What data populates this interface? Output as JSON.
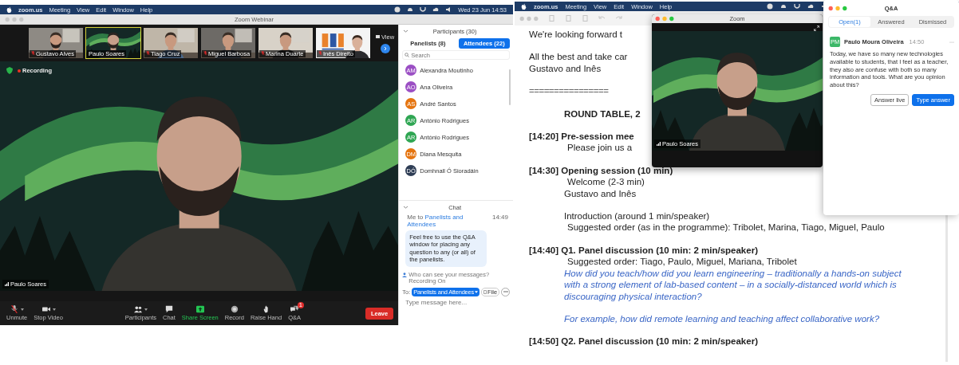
{
  "left_window": {
    "menu_bar": {
      "items": [
        "zoom.us",
        "Meeting",
        "View",
        "Edit",
        "Window",
        "Help"
      ],
      "clock": "Wed 23 Jun 14:53"
    },
    "title": "Zoom Webinar",
    "thumbnails": [
      {
        "name": "Gustavo Alves",
        "muted": true,
        "selected": false
      },
      {
        "name": "Paulo Soares",
        "muted": false,
        "selected": true
      },
      {
        "name": "Tiago Cruz",
        "muted": true,
        "selected": false
      },
      {
        "name": "Miguel Barbosa",
        "muted": true,
        "selected": false
      },
      {
        "name": "Marina Duarte",
        "muted": true,
        "selected": false
      },
      {
        "name": "Inês Direito",
        "muted": true,
        "selected": false
      }
    ],
    "view_button": "View",
    "recording": "Recording",
    "speaker_name": "Paulo Soares",
    "toolbar": [
      {
        "kind": "mic-off",
        "label": "Unmute",
        "has_menu": true
      },
      {
        "kind": "video",
        "label": "Stop Video",
        "has_menu": true
      },
      {
        "kind": "people",
        "label": "Participants",
        "has_menu": true
      },
      {
        "kind": "chat",
        "label": "Chat",
        "has_menu": false
      },
      {
        "kind": "share",
        "label": "Share Screen",
        "has_menu": false
      },
      {
        "kind": "record",
        "label": "Record",
        "has_menu": false
      },
      {
        "kind": "hand",
        "label": "Raise Hand",
        "has_menu": false
      },
      {
        "kind": "qa",
        "label": "Q&A",
        "has_menu": false,
        "badge": "1"
      }
    ],
    "leave_button": "Leave",
    "participants": {
      "title": "Participants (30)",
      "tabs": [
        {
          "label": "Panelists (8)",
          "selected": false
        },
        {
          "label": "Attendees (22)",
          "selected": true
        }
      ],
      "search_placeholder": "Search",
      "items": [
        {
          "initials": "AM",
          "name": "Alexandra Moutinho",
          "color": "#9b4fc4"
        },
        {
          "initials": "AO",
          "name": "Ana Oliveira",
          "color": "#9b4fc4"
        },
        {
          "initials": "AS",
          "name": "André Santos",
          "color": "#e5740f"
        },
        {
          "initials": "AR",
          "name": "António Rodrigues",
          "color": "#2fa653"
        },
        {
          "initials": "AR",
          "name": "António Rodrigues",
          "color": "#2fa653"
        },
        {
          "initials": "DM",
          "name": "Diana Mesquita",
          "color": "#e5740f"
        },
        {
          "initials": "DÓ",
          "name": "Domhnall Ó Sioradáin",
          "color": "#2e3d55"
        }
      ]
    },
    "chat": {
      "title": "Chat",
      "sender": "Me to",
      "recipient": "Panelists and Attendees",
      "time": "14:49",
      "message": "Feel free to use the Q&A window for placing any question to any (or all) of the panelists.",
      "notice": "Who can see your messages? Recording On",
      "to_label": "To:",
      "to_value": "Panelists and Attendees",
      "file_button": "File",
      "placeholder": "Type message here..."
    }
  },
  "right_window": {
    "menu_bar": {
      "items": [
        "zoom.us",
        "Meeting",
        "View",
        "Edit",
        "Window",
        "Help"
      ]
    },
    "document": [
      {
        "lines": [
          {
            "kind": "plain",
            "text": "We're looking forward t"
          }
        ]
      },
      {
        "lines": [
          {
            "kind": "plain",
            "text": "All the best and take car"
          },
          {
            "kind": "plain",
            "text": "Gustavo and Inês"
          }
        ]
      },
      {
        "lines": [
          {
            "kind": "rule",
            "text": "================"
          }
        ]
      },
      {
        "lines": [
          {
            "kind": "title",
            "text": "ROUND TABLE, 2"
          }
        ]
      },
      {
        "lines": [
          {
            "kind": "heading",
            "text": "[14:20] Pre-session mee"
          },
          {
            "kind": "sub",
            "text": "Please join us a"
          }
        ]
      },
      {
        "lines": [
          {
            "kind": "heading",
            "text": "[14:30] Opening session (10 min)"
          },
          {
            "kind": "sub",
            "text": "Welcome (2-3 min)"
          },
          {
            "kind": "indent",
            "text": "Gustavo and Inês"
          }
        ]
      },
      {
        "lines": [
          {
            "kind": "indent",
            "text": "Introduction (around 1 min/speaker)"
          },
          {
            "kind": "sub",
            "text": "Suggested order (as in the programme): Tribolet, Marina, Tiago, Miguel, Paulo"
          }
        ]
      },
      {
        "lines": [
          {
            "kind": "heading",
            "text": "[14:40] Q1. Panel discussion (10 min: 2 min/speaker)"
          },
          {
            "kind": "sub",
            "text": "Suggested order: Tiago, Paulo, Miguel, Mariana, Tribolet"
          },
          {
            "kind": "question",
            "text": "How did you teach/how did you learn engineering – traditionally a hands-on subject with a strong element of lab-based content – in a socially-distanced world which is discouraging physical interaction?"
          }
        ]
      },
      {
        "lines": [
          {
            "kind": "question",
            "text": "For example, how did remote learning and teaching affect collaborative work?"
          }
        ]
      },
      {
        "lines": [
          {
            "kind": "heading",
            "text": "[14:50] Q2. Panel discussion (10 min: 2 min/speaker)"
          }
        ]
      }
    ],
    "zoom_window": {
      "title": "Zoom",
      "speaker_name": "Paulo Soares"
    },
    "qa_window": {
      "title": "Q&A",
      "tabs": [
        {
          "label": "Open(1)",
          "selected": true
        },
        {
          "label": "Answered",
          "selected": false
        },
        {
          "label": "Dismissed",
          "selected": false
        }
      ],
      "questions": [
        {
          "initials": "PM",
          "author": "Paulo Moura Oliveira",
          "time": "14:50",
          "text": "Today, we have so many new technologies available to students, that I feel as a teacher, they also are confuse with both so many information and tools. What are you opinion about this?",
          "buttons": [
            {
              "label": "Answer live",
              "kind": "secondary"
            },
            {
              "label": "Type answer",
              "kind": "primary"
            }
          ]
        }
      ]
    }
  }
}
